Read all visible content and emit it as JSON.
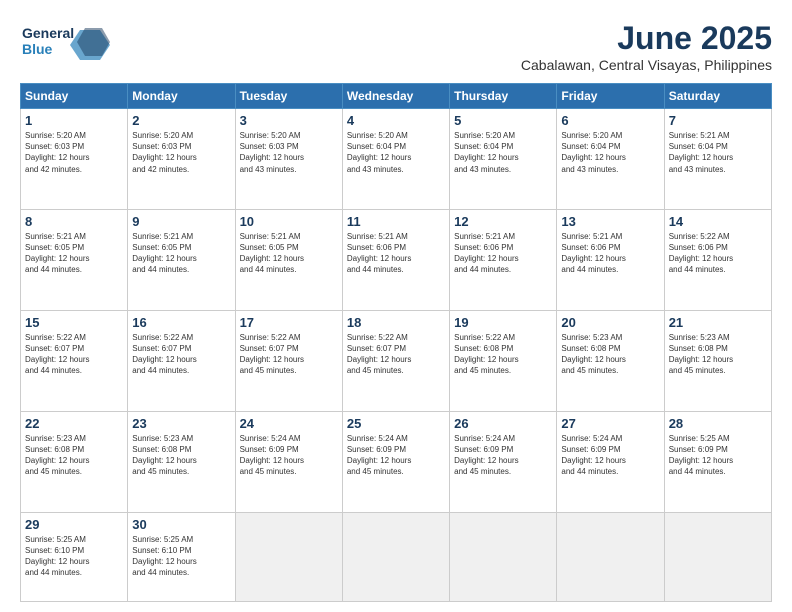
{
  "logo": {
    "general": "General",
    "blue": "Blue"
  },
  "title": "June 2025",
  "subtitle": "Cabalawan, Central Visayas, Philippines",
  "headers": [
    "Sunday",
    "Monday",
    "Tuesday",
    "Wednesday",
    "Thursday",
    "Friday",
    "Saturday"
  ],
  "weeks": [
    [
      {
        "day": "1",
        "info": "Sunrise: 5:20 AM\nSunset: 6:03 PM\nDaylight: 12 hours\nand 42 minutes."
      },
      {
        "day": "2",
        "info": "Sunrise: 5:20 AM\nSunset: 6:03 PM\nDaylight: 12 hours\nand 42 minutes."
      },
      {
        "day": "3",
        "info": "Sunrise: 5:20 AM\nSunset: 6:03 PM\nDaylight: 12 hours\nand 43 minutes."
      },
      {
        "day": "4",
        "info": "Sunrise: 5:20 AM\nSunset: 6:04 PM\nDaylight: 12 hours\nand 43 minutes."
      },
      {
        "day": "5",
        "info": "Sunrise: 5:20 AM\nSunset: 6:04 PM\nDaylight: 12 hours\nand 43 minutes."
      },
      {
        "day": "6",
        "info": "Sunrise: 5:20 AM\nSunset: 6:04 PM\nDaylight: 12 hours\nand 43 minutes."
      },
      {
        "day": "7",
        "info": "Sunrise: 5:21 AM\nSunset: 6:04 PM\nDaylight: 12 hours\nand 43 minutes."
      }
    ],
    [
      {
        "day": "8",
        "info": "Sunrise: 5:21 AM\nSunset: 6:05 PM\nDaylight: 12 hours\nand 44 minutes."
      },
      {
        "day": "9",
        "info": "Sunrise: 5:21 AM\nSunset: 6:05 PM\nDaylight: 12 hours\nand 44 minutes."
      },
      {
        "day": "10",
        "info": "Sunrise: 5:21 AM\nSunset: 6:05 PM\nDaylight: 12 hours\nand 44 minutes."
      },
      {
        "day": "11",
        "info": "Sunrise: 5:21 AM\nSunset: 6:06 PM\nDaylight: 12 hours\nand 44 minutes."
      },
      {
        "day": "12",
        "info": "Sunrise: 5:21 AM\nSunset: 6:06 PM\nDaylight: 12 hours\nand 44 minutes."
      },
      {
        "day": "13",
        "info": "Sunrise: 5:21 AM\nSunset: 6:06 PM\nDaylight: 12 hours\nand 44 minutes."
      },
      {
        "day": "14",
        "info": "Sunrise: 5:22 AM\nSunset: 6:06 PM\nDaylight: 12 hours\nand 44 minutes."
      }
    ],
    [
      {
        "day": "15",
        "info": "Sunrise: 5:22 AM\nSunset: 6:07 PM\nDaylight: 12 hours\nand 44 minutes."
      },
      {
        "day": "16",
        "info": "Sunrise: 5:22 AM\nSunset: 6:07 PM\nDaylight: 12 hours\nand 44 minutes."
      },
      {
        "day": "17",
        "info": "Sunrise: 5:22 AM\nSunset: 6:07 PM\nDaylight: 12 hours\nand 45 minutes."
      },
      {
        "day": "18",
        "info": "Sunrise: 5:22 AM\nSunset: 6:07 PM\nDaylight: 12 hours\nand 45 minutes."
      },
      {
        "day": "19",
        "info": "Sunrise: 5:22 AM\nSunset: 6:08 PM\nDaylight: 12 hours\nand 45 minutes."
      },
      {
        "day": "20",
        "info": "Sunrise: 5:23 AM\nSunset: 6:08 PM\nDaylight: 12 hours\nand 45 minutes."
      },
      {
        "day": "21",
        "info": "Sunrise: 5:23 AM\nSunset: 6:08 PM\nDaylight: 12 hours\nand 45 minutes."
      }
    ],
    [
      {
        "day": "22",
        "info": "Sunrise: 5:23 AM\nSunset: 6:08 PM\nDaylight: 12 hours\nand 45 minutes."
      },
      {
        "day": "23",
        "info": "Sunrise: 5:23 AM\nSunset: 6:08 PM\nDaylight: 12 hours\nand 45 minutes."
      },
      {
        "day": "24",
        "info": "Sunrise: 5:24 AM\nSunset: 6:09 PM\nDaylight: 12 hours\nand 45 minutes."
      },
      {
        "day": "25",
        "info": "Sunrise: 5:24 AM\nSunset: 6:09 PM\nDaylight: 12 hours\nand 45 minutes."
      },
      {
        "day": "26",
        "info": "Sunrise: 5:24 AM\nSunset: 6:09 PM\nDaylight: 12 hours\nand 45 minutes."
      },
      {
        "day": "27",
        "info": "Sunrise: 5:24 AM\nSunset: 6:09 PM\nDaylight: 12 hours\nand 44 minutes."
      },
      {
        "day": "28",
        "info": "Sunrise: 5:25 AM\nSunset: 6:09 PM\nDaylight: 12 hours\nand 44 minutes."
      }
    ],
    [
      {
        "day": "29",
        "info": "Sunrise: 5:25 AM\nSunset: 6:10 PM\nDaylight: 12 hours\nand 44 minutes."
      },
      {
        "day": "30",
        "info": "Sunrise: 5:25 AM\nSunset: 6:10 PM\nDaylight: 12 hours\nand 44 minutes."
      },
      null,
      null,
      null,
      null,
      null
    ]
  ]
}
